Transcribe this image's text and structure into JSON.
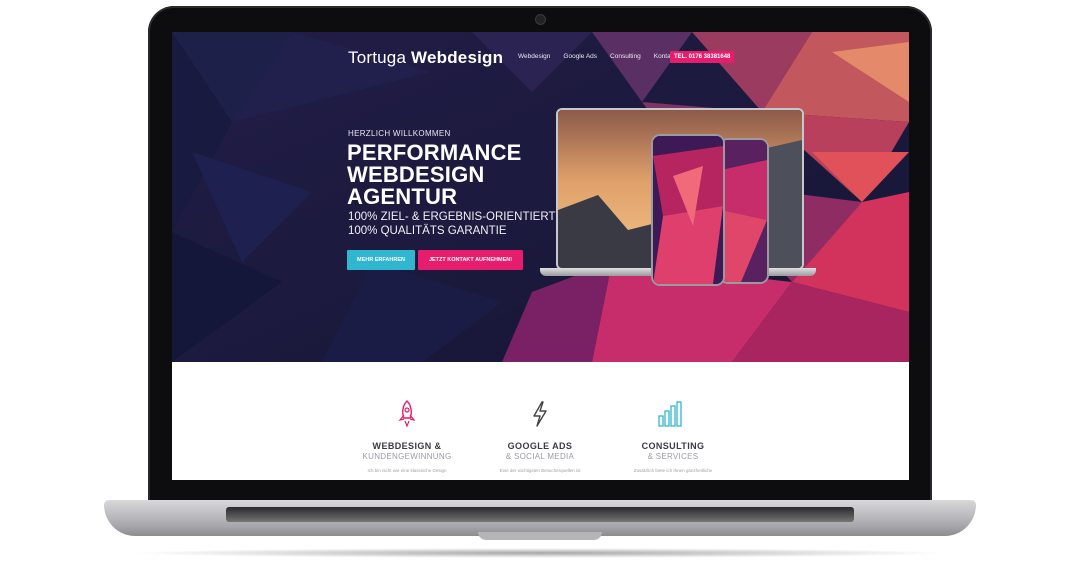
{
  "site": {
    "brand_light": "Tortuga",
    "brand_bold": "Webdesign",
    "nav": [
      "Webdesign",
      "Google Ads",
      "Consulting",
      "Kontakt"
    ],
    "phone_label": "TEL. 0176 38381648"
  },
  "hero": {
    "eyebrow": "HERZLICH WILLKOMMEN",
    "title_lines": [
      "PERFORMANCE",
      "WEBDESIGN",
      "AGENTUR"
    ],
    "sub_lines": [
      "100% ZIEL- & ERGEBNIS-ORIENTIERT",
      "100% QUALITÄTS GARANTIE"
    ],
    "btn_more": "MEHR ERFAHREN",
    "btn_contact": "JETZT KONTAKT AUFNEHMEN!"
  },
  "services": [
    {
      "icon": "rocket-icon",
      "title": "WEBDESIGN &",
      "subtitle": "KUNDENGEWINNUNG",
      "text": "Ich bin nicht wie eine klassische Design"
    },
    {
      "icon": "lightning-icon",
      "title": "GOOGLE ADS",
      "subtitle": "& SOCIAL MEDIA",
      "text": "Eine der wichtigsten Besucherquellen ist"
    },
    {
      "icon": "bar-chart-icon",
      "title": "CONSULTING",
      "subtitle": "& SERVICES",
      "text": "Zusätzlich biete ich Ihnen ganzheitliche"
    }
  ],
  "colors": {
    "accent_pink": "#e61c6c",
    "accent_cyan": "#31b6cf",
    "hero_bg": "#1a1b3d"
  }
}
